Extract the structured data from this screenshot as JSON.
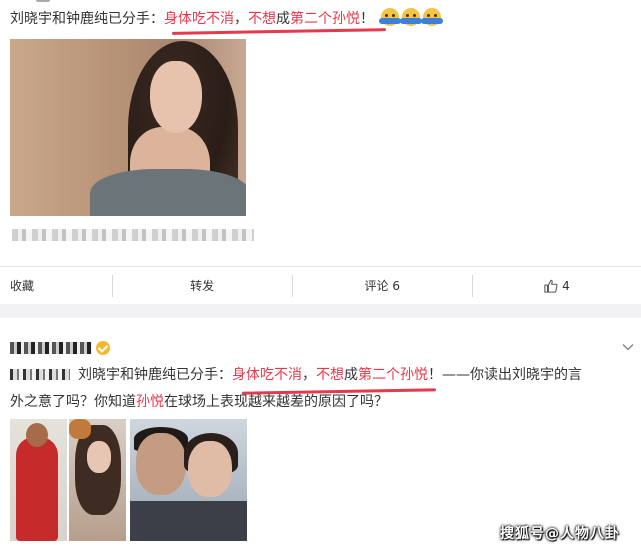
{
  "post1": {
    "text_prefix": "刘晓宇和钟鹿纯已分手：",
    "text_red1": "身体吃不消",
    "text_sep": "，",
    "text_red2": "不想",
    "text_mid": "成",
    "text_red3": "第二个孙悦",
    "text_end": "！",
    "emoji_count": 3,
    "emoji_name": "hug-emoji",
    "actions": {
      "favorite": "收藏",
      "repost": "转发",
      "comment": "评论 6",
      "like": "4"
    }
  },
  "post2": {
    "text_prefix": "刘晓宇和钟鹿纯已分手：",
    "text_red1": "身体吃不消",
    "text_sep": "，",
    "text_red2": "不想",
    "text_mid": "成",
    "text_red3": "第二个孙悦",
    "text_tail": "！——你读出刘晓宇的言",
    "line2_a": "外之意了吗？你知道",
    "line2_red": "孙悦",
    "line2_b": "在球场上表现越来越差的原因了吗？"
  },
  "watermark": "搜狐号@人物八卦",
  "colors": {
    "highlight": "#e8384b",
    "underline": "#e33a4e",
    "divider": "#f2f2f5",
    "verified": "#f5b82e"
  }
}
